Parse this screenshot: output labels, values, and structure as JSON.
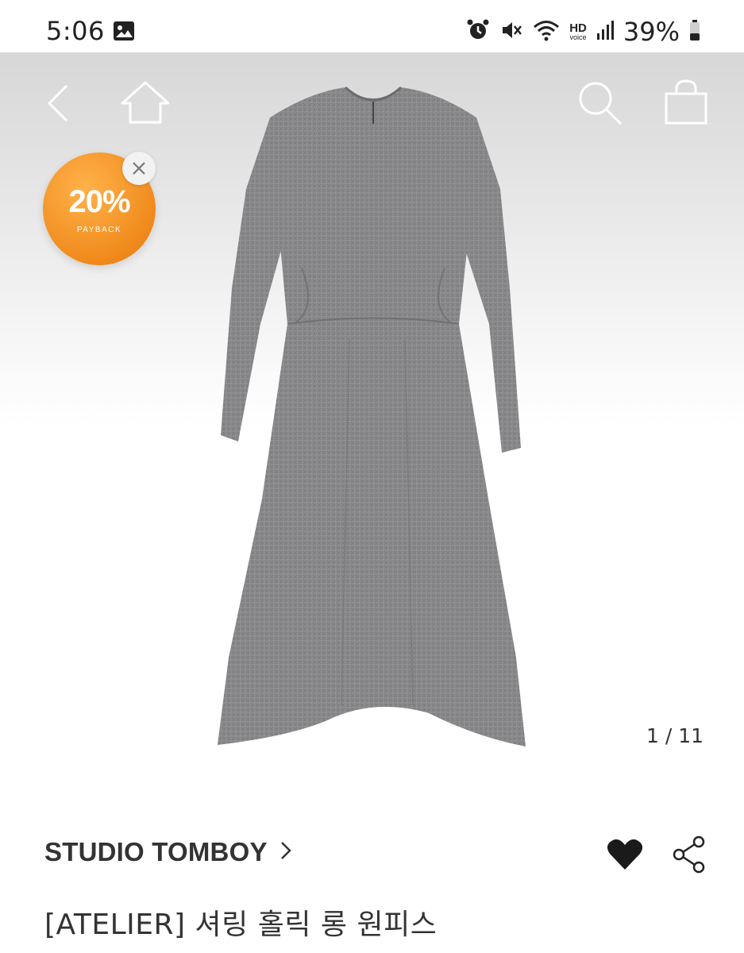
{
  "status_bar": {
    "time": "5:06",
    "battery_percent": "39%",
    "hd_label": "HD",
    "voice_label": "voice",
    "icons": [
      "gallery-icon",
      "alarm-icon",
      "mute-icon",
      "wifi-icon",
      "hd-voice-icon",
      "signal-icon",
      "battery-icon"
    ]
  },
  "nav": {
    "icons": [
      "back-icon",
      "home-icon",
      "search-icon",
      "shopping-bag-icon"
    ]
  },
  "promo": {
    "percent": "20%",
    "label": "PAYBACK"
  },
  "gallery": {
    "counter": "1 / 11"
  },
  "product": {
    "brand": "STUDIO TOMBOY",
    "title": "[ATELIER] 셔링 홀릭 롱 원피스",
    "wishlisted": true
  },
  "colors": {
    "promo_orange": "#f08a1c",
    "text_dark": "#333333",
    "dress_gray": "#8a8a8c"
  }
}
